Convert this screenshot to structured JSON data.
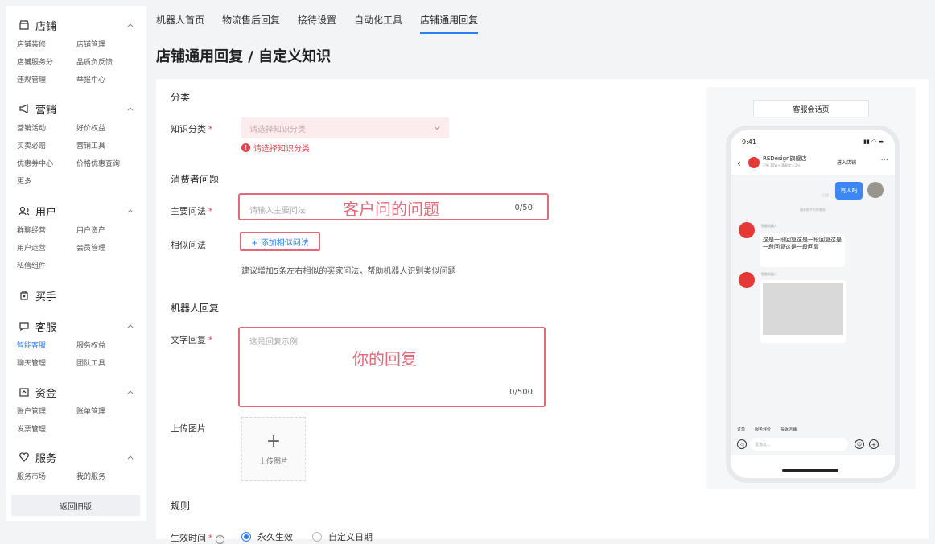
{
  "sidebar": {
    "sections": [
      {
        "icon": "store-icon",
        "title": "店铺",
        "items": [
          "店铺装修",
          "店铺管理",
          "店铺服务分",
          "品质负反馈",
          "违规管理",
          "举报中心"
        ]
      },
      {
        "icon": "megaphone-icon",
        "title": "营销",
        "items": [
          "营销活动",
          "好价权益",
          "买卖必赔",
          "营销工具",
          "优惠券中心",
          "价格优惠查询",
          "更多"
        ]
      },
      {
        "icon": "users-icon",
        "title": "用户",
        "items": [
          "群聊经营",
          "用户资产",
          "用户运营",
          "会员管理",
          "私信组件"
        ]
      },
      {
        "icon": "buyer-icon",
        "title": "买手",
        "items": []
      },
      {
        "icon": "chat-icon",
        "title": "客服",
        "items": [
          "智能客服",
          "服务权益",
          "聊天管理",
          "团队工具"
        ],
        "active": "智能客服"
      },
      {
        "icon": "wallet-icon",
        "title": "资金",
        "items": [
          "账户管理",
          "账单管理",
          "发票管理"
        ]
      },
      {
        "icon": "heart-icon",
        "title": "服务",
        "items": [
          "服务市场",
          "我的服务"
        ]
      }
    ],
    "back_button": "返回旧版"
  },
  "tabs": [
    "机器人首页",
    "物流售后回复",
    "接待设置",
    "自动化工具",
    "店铺通用回复"
  ],
  "active_tab": "店铺通用回复",
  "page_title": "店铺通用回复 / 自定义知识",
  "form": {
    "group_category": "分类",
    "category_label": "知识分类",
    "category_placeholder": "请选择知识分类",
    "category_error": "请选择知识分类",
    "group_question": "消费者问题",
    "main_q_label": "主要问法",
    "main_q_placeholder": "请输入主要问法",
    "main_q_counter": "0/50",
    "main_q_annotation": "客户问的问题",
    "similar_label": "相似问法",
    "add_similar": "+ 添加相似问法",
    "similar_hint": "建议增加5条左右相似的买家问法，帮助机器人识别类似问题",
    "group_reply": "机器人回复",
    "text_reply_label": "文字回复",
    "text_reply_placeholder": "这是回复示例",
    "text_reply_counter": "0/500",
    "text_reply_annotation": "你的回复",
    "upload_label": "上传图片",
    "upload_text": "上传图片",
    "group_rules": "规则",
    "effective_label": "生效时间",
    "radio_forever": "永久生效",
    "radio_custom": "自定义日期"
  },
  "preview": {
    "title": "客服会话页",
    "status_time": "9:41",
    "shop_name": "REDesign旗舰店",
    "shop_sub": "已售 10W+   满意度 4.2分",
    "enter_shop": "进入店铺",
    "user_message": "有人吗",
    "read_mark": "已读",
    "system_note": "服务助手为你服务",
    "bot_name": "智能机器人",
    "bot_reply": "这是一段回复这是一段回复这是一段回复这是一段回复",
    "quick_actions": [
      "订单",
      "服务评价",
      "投诉店铺"
    ],
    "input_placeholder": "发消息..."
  },
  "colors": {
    "accent": "#2e7cf6",
    "error": "#e4434f",
    "annotation": "#e06a7a"
  }
}
